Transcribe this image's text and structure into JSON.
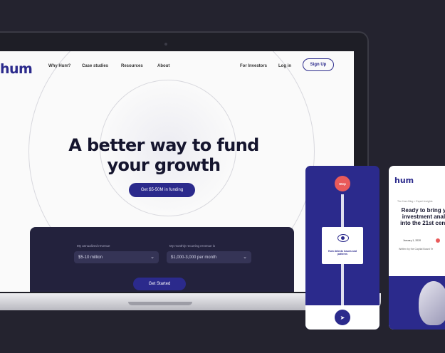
{
  "brand": {
    "logo_text": "hum",
    "accent": "#2b2a8c",
    "dark": "#23223d",
    "alert": "#e95a5a"
  },
  "nav": {
    "links": [
      "Why Hum?",
      "Case studies",
      "Resources",
      "About"
    ],
    "for_investors": "For Investors",
    "login": "Log in",
    "signup": "Sign Up"
  },
  "hero": {
    "line1": "A better way to fund",
    "line2": "your growth",
    "cta": "Get $5-50M in funding"
  },
  "form": {
    "revenue_label": "My annualized revenue",
    "revenue_value": "$5-10 million",
    "recurring_label": "My monthly recurring revenue is",
    "recurring_value": "$1,000-3,000 per month",
    "submit": "Get Started"
  },
  "phone1": {
    "badge": "Step",
    "card_text": "Hum detects issues and patterns"
  },
  "phone2": {
    "logo_text": "hum",
    "crumb": "The Hum Blog > Expert Insights",
    "headline": [
      "Ready to bring y",
      "investment anal",
      "into the 21st cent"
    ],
    "date": "January 1, 2020",
    "writer": "Written by the Capital Board Te"
  }
}
